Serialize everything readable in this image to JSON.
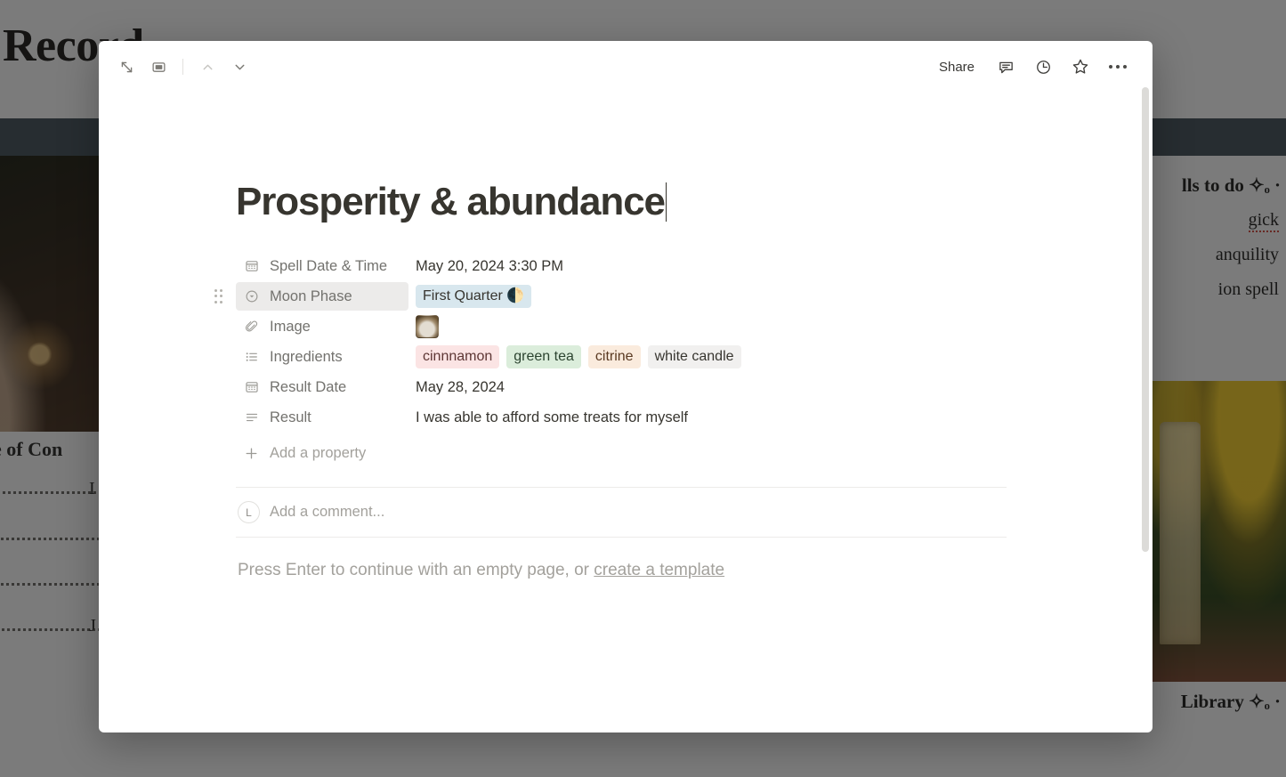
{
  "background": {
    "title": "ell Record",
    "toc_heading": "Table of Con",
    "toc_entries": [
      {
        "letter": "I"
      },
      {
        "letter": ""
      },
      {
        "letter": ""
      },
      {
        "letter": ""
      },
      {
        "letter": "J"
      }
    ],
    "right_heading_1": "lls to do ✧ₒ ·",
    "right_items": [
      "gick",
      "anquility",
      "ion spell"
    ],
    "right_heading_2": "Library ✧ₒ ·"
  },
  "toolbar": {
    "expand_icon": "expand-arrows-icon",
    "sidepeek_icon": "side-peek-icon",
    "prev_icon": "chevron-up-icon",
    "next_icon": "chevron-down-icon",
    "share_label": "Share",
    "comment_icon": "comment-bubble-icon",
    "history_icon": "clock-history-icon",
    "favorite_icon": "star-icon",
    "more_icon": "more-horizontal-icon"
  },
  "page": {
    "title": "Prosperity & abundance"
  },
  "properties": [
    {
      "name": "Spell Date & Time",
      "icon": "calendar-icon",
      "type": "date",
      "value": "May 20, 2024 3:30 PM"
    },
    {
      "name": "Moon Phase",
      "icon": "select-circle-icon",
      "type": "select",
      "hovered": true,
      "tags": [
        {
          "label": "First Quarter 🌓",
          "color": "blue"
        }
      ]
    },
    {
      "name": "Image",
      "icon": "paperclip-icon",
      "type": "files",
      "thumbnail": "spell-image-thumbnail"
    },
    {
      "name": "Ingredients",
      "icon": "multi-select-icon",
      "type": "multi_select",
      "tags": [
        {
          "label": "cinnnamon",
          "color": "pink"
        },
        {
          "label": "green tea",
          "color": "green"
        },
        {
          "label": "citrine",
          "color": "orange"
        },
        {
          "label": "white candle",
          "color": "gray"
        }
      ]
    },
    {
      "name": "Result Date",
      "icon": "calendar-icon",
      "type": "date",
      "value": "May 28, 2024"
    },
    {
      "name": "Result",
      "icon": "text-lines-icon",
      "type": "text",
      "value": "I was able to afford some treats for myself"
    }
  ],
  "add_property": {
    "label": "Add a property",
    "icon": "plus-icon"
  },
  "comment": {
    "avatar_initial": "L",
    "placeholder": "Add a comment..."
  },
  "empty_state": {
    "text_before": "Press Enter to continue with an empty page, or ",
    "link": "create a template"
  },
  "colors": {
    "tag_blue": "#d8e7ee",
    "tag_pink": "#fbe4e4",
    "tag_green": "#dbeddb",
    "tag_orange": "#faebdd",
    "tag_gray": "#f1f0ef",
    "text": "#37352f",
    "muted": "#a3a19c"
  }
}
